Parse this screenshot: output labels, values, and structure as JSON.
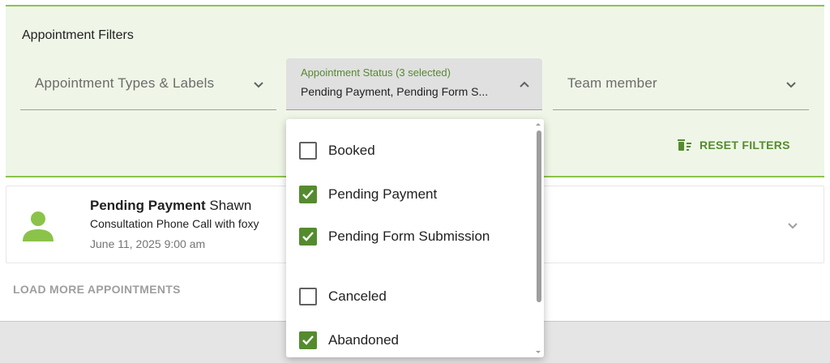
{
  "filters": {
    "title": "Appointment Filters",
    "types_label": "Appointment Types & Labels",
    "status_caption": "Appointment Status (3 selected)",
    "status_value": "Pending Payment, Pending Form S...",
    "team_label": "Team member",
    "reset_label": "RESET FILTERS"
  },
  "status_options": [
    {
      "label": "Booked",
      "checked": false
    },
    {
      "label": "Pending Payment",
      "checked": true
    },
    {
      "label": "Pending Form Submission",
      "checked": true
    },
    {
      "label": "Canceled",
      "checked": false
    },
    {
      "label": "Abandoned",
      "checked": true
    }
  ],
  "appointment": {
    "status": "Pending Payment",
    "name": "Shawn",
    "description": "Consultation Phone Call with foxy",
    "datetime": "June 11, 2025 9:00 am"
  },
  "load_more_label": "LOAD MORE APPOINTMENTS",
  "colors": {
    "accent": "#558b2f",
    "avatar": "#8bc34a",
    "panel_bg": "#eff6e7"
  },
  "icons": [
    "chevron-down-icon",
    "chevron-up-icon",
    "trash-filter-icon",
    "person-icon"
  ]
}
